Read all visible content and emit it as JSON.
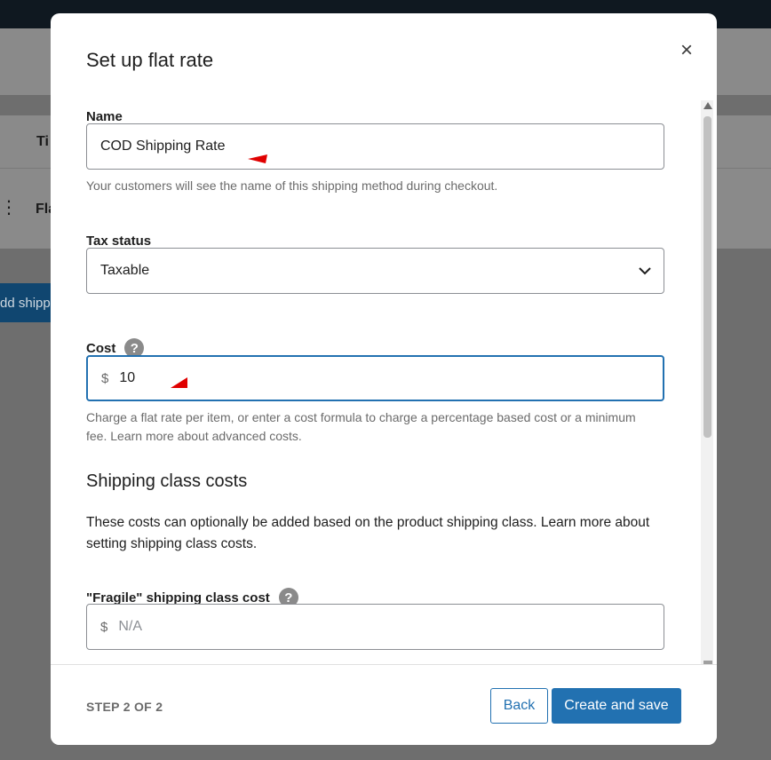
{
  "background": {
    "column_header_fragment": "Ti",
    "row_label_fragment": "Fla",
    "add_button_fragment": "dd shipp"
  },
  "modal": {
    "title": "Set up flat rate",
    "close_label": "×"
  },
  "form": {
    "name": {
      "label": "Name",
      "value": "COD Shipping Rate",
      "help": "Your customers will see the name of this shipping method during checkout."
    },
    "tax_status": {
      "label": "Tax status",
      "value": "Taxable"
    },
    "cost": {
      "label": "Cost",
      "help_icon": "?",
      "currency": "$",
      "value": "10",
      "help": "Charge a flat rate per item, or enter a cost formula to charge a percentage based cost or a minimum fee. Learn more about advanced costs."
    },
    "shipping_class": {
      "section_title": "Shipping class costs",
      "description": "These costs can optionally be added based on the product shipping class. Learn more about setting shipping class costs.",
      "fragile": {
        "label": "\"Fragile\" shipping class cost",
        "help_icon": "?",
        "currency": "$",
        "placeholder": "N/A"
      }
    }
  },
  "footer": {
    "step": "STEP 2 OF 2",
    "back_label": "Back",
    "save_label": "Create and save"
  },
  "colors": {
    "primary": "#2271b1",
    "annotation_arrow": "#e00000"
  }
}
